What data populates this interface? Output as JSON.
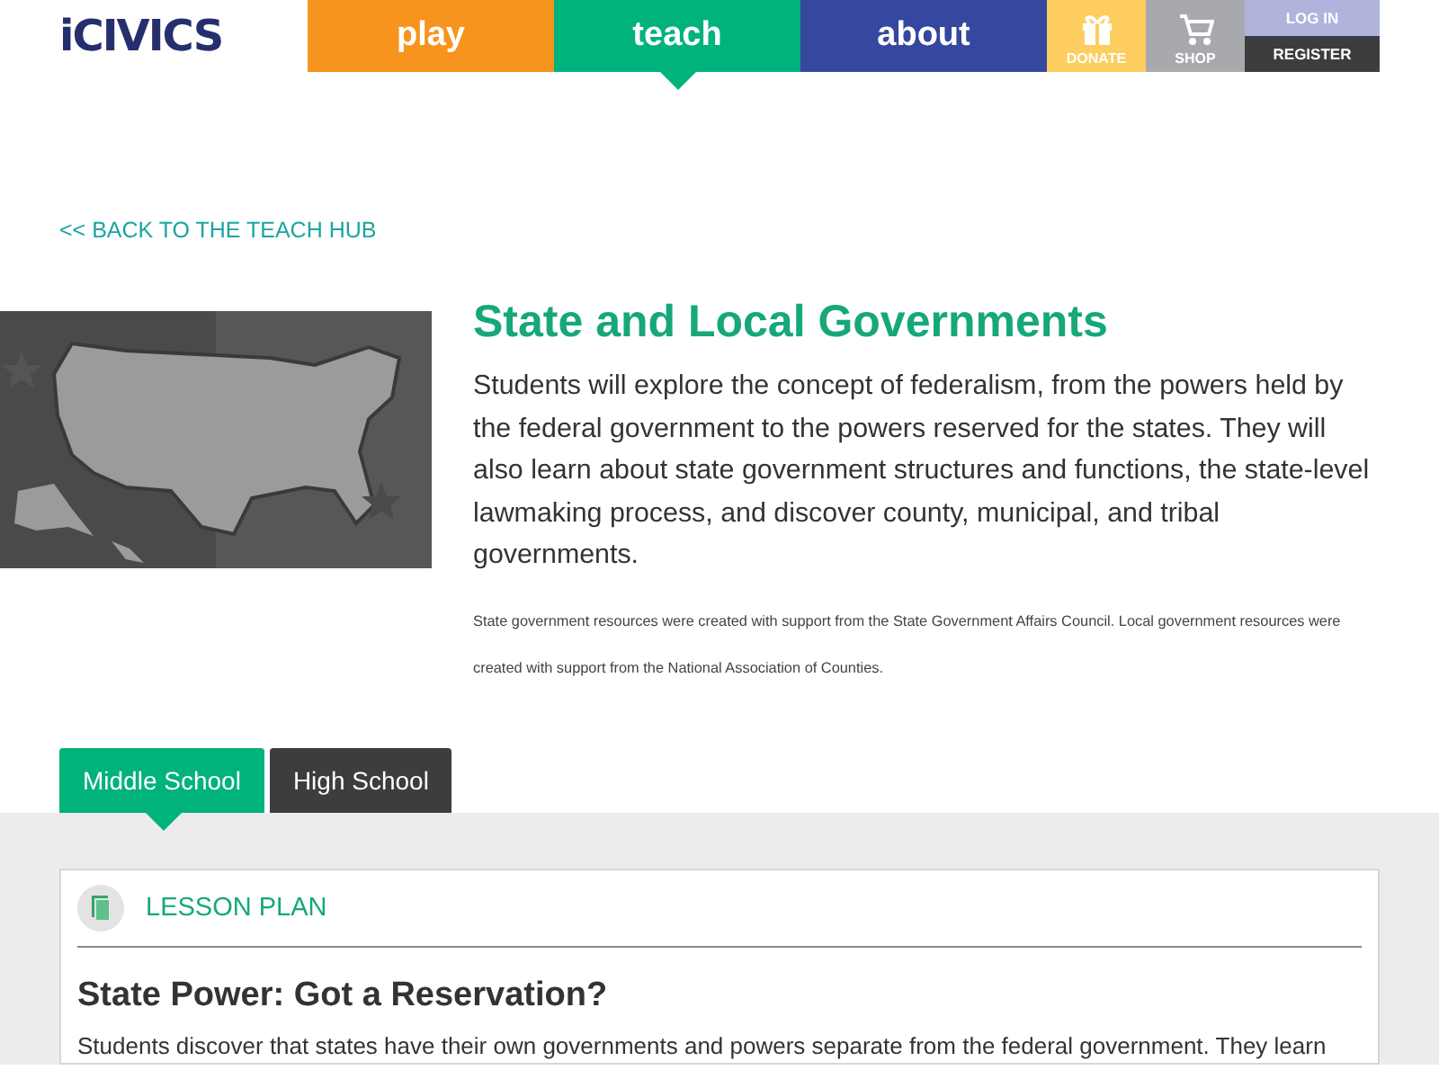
{
  "header": {
    "logo": "iCIVICS",
    "nav": [
      {
        "label": "play",
        "kind": "main",
        "color": "#f7941d",
        "selected": false
      },
      {
        "label": "teach",
        "kind": "main",
        "color": "#00b27b",
        "selected": true
      },
      {
        "label": "about",
        "kind": "main",
        "color": "#35479e",
        "selected": false
      },
      {
        "label": "DONATE",
        "kind": "gift",
        "color": "#fdcd5f",
        "selected": false
      },
      {
        "label": "SHOP",
        "kind": "cart",
        "color": "#a7a9ac",
        "selected": false
      }
    ],
    "account": [
      "LOG IN",
      "REGISTER"
    ]
  },
  "back_link": "<< BACK TO THE TEACH HUB",
  "title": "State and Local Governments",
  "description": "Students will explore the concept of federalism, from the powers held by the federal government to the powers reserved for the states. They will also learn about state government structures and functions, the state-level lawmaking process, and discover county, municipal, and tribal governments.",
  "credit": "State government resources were created with support from the State Government Affairs Council. Local government resources were created with support from the National Association of Counties.",
  "tabs": [
    {
      "label": "Middle School",
      "selected": true
    },
    {
      "label": "High School",
      "selected": false
    }
  ],
  "lesson": {
    "type": "LESSON PLAN",
    "title": "State Power: Got a Reservation?",
    "summary": "Students discover that states have their own governments and powers separate from the federal government. They learn"
  }
}
